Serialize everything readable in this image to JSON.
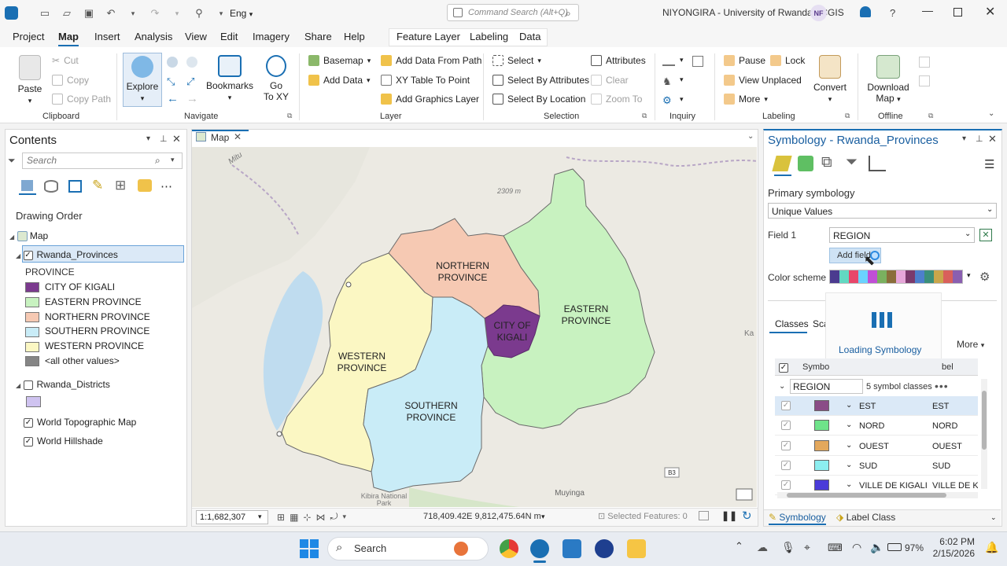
{
  "titlebar": {
    "language": "Eng",
    "command_search_placeholder": "Command Search (Alt+Q)",
    "user": "NIYONGIRA - University of Rwanda - CGIS",
    "avatar_initials": "NF",
    "help": "?"
  },
  "menu": {
    "tabs": [
      "Project",
      "Map",
      "Insert",
      "Analysis",
      "View",
      "Edit",
      "Imagery",
      "Share",
      "Help"
    ],
    "active": "Map",
    "contextual_tabs": [
      "Feature Layer",
      "Labeling",
      "Data"
    ]
  },
  "ribbon": {
    "clipboard": {
      "paste": "Paste",
      "cut": "Cut",
      "copy": "Copy",
      "copy_path": "Copy Path",
      "group": "Clipboard"
    },
    "navigate": {
      "explore": "Explore",
      "bookmarks": "Bookmarks",
      "go_to_xy": [
        "Go",
        "To XY"
      ],
      "group": "Navigate"
    },
    "layer": {
      "basemap": "Basemap",
      "add_data": "Add Data",
      "add_data_from_path": "Add Data From Path",
      "xy_table": "XY Table To Point",
      "add_graphics": "Add Graphics Layer",
      "group": "Layer"
    },
    "selection": {
      "select": "Select",
      "by_attributes": "Select By Attributes",
      "by_location": "Select By Location",
      "attributes": "Attributes",
      "clear": "Clear",
      "zoom_to": "Zoom To",
      "group": "Selection"
    },
    "inquiry": {
      "group": "Inquiry"
    },
    "labeling": {
      "pause": "Pause",
      "lock": "Lock",
      "view_unplaced": "View Unplaced",
      "more": "More",
      "convert": "Convert",
      "group": "Labeling"
    },
    "offline": {
      "download": [
        "Download",
        "Map"
      ],
      "group": "Offline"
    }
  },
  "contents": {
    "title": "Contents",
    "search_placeholder": "Search",
    "drawing_order": "Drawing Order",
    "map_label": "Map",
    "layer_provinces": "Rwanda_Provinces",
    "field_heading": "PROVINCE",
    "legend": [
      {
        "label": "CITY OF KIGALI",
        "color": "#7b3a8e"
      },
      {
        "label": "EASTERN PROVINCE",
        "color": "#c8f2c0"
      },
      {
        "label": "NORTHERN PROVINCE",
        "color": "#f6c9b3"
      },
      {
        "label": "SOUTHERN PROVINCE",
        "color": "#c9ecf7"
      },
      {
        "label": "WESTERN PROVINCE",
        "color": "#fbf7c3"
      },
      {
        "label": "<all other values>",
        "color": "#858585"
      }
    ],
    "layer_districts": "Rwanda_Districts",
    "districts_color": "#cfc3f0",
    "basemaps": [
      "World Topographic Map",
      "World Hillshade"
    ]
  },
  "map": {
    "tab": "Map",
    "labels": {
      "northern": [
        "NORTHERN",
        "PROVINCE"
      ],
      "eastern": [
        "EASTERN",
        "PROVINCE"
      ],
      "kigali": [
        "CITY OF",
        "KIGALI"
      ],
      "western": [
        "WESTERN",
        "PROVINCE"
      ],
      "southern": [
        "SOUTHERN",
        "PROVINCE"
      ]
    },
    "base_labels": {
      "elev": "2309 m",
      "mitu": "Mitu",
      "ka": "Ka",
      "kibira": [
        "Kibira National",
        "Park"
      ],
      "muyinga": "Muyinga",
      "b3": "B3"
    },
    "scale": "1:1,682,307",
    "coords": "718,409.42E 9,812,475.64N m",
    "selected_features": "Selected Features: 0"
  },
  "symbology": {
    "title": "Symbology - Rwanda_Provinces",
    "primary": "Primary symbology",
    "method": "Unique Values",
    "field_label": "Field 1",
    "field_value": "REGION",
    "add_field": "Add field",
    "color_scheme_label": "Color scheme",
    "scheme_colors": [
      "#4b3b8f",
      "#62d9c2",
      "#e8466a",
      "#6ad3ff",
      "#c04fd6",
      "#7ab05f",
      "#8a6d3b",
      "#e6a6d9",
      "#7b3a6c",
      "#4d7fcc",
      "#3b8f7a",
      "#c9a64b",
      "#d9605b",
      "#8a5fb0"
    ],
    "tabs": [
      "Classes",
      "Sca"
    ],
    "loading": "Loading Symbology",
    "more": "More",
    "col_symbol": "Symbo",
    "col_label": "bel",
    "group_field": "REGION",
    "group_count": "5 symbol classes",
    "rows": [
      {
        "value": "EST",
        "label": "EST",
        "color": "#8a4c87"
      },
      {
        "value": "NORD",
        "label": "NORD",
        "color": "#6fe38a"
      },
      {
        "value": "OUEST",
        "label": "OUEST",
        "color": "#e3a85d"
      },
      {
        "value": "SUD",
        "label": "SUD",
        "color": "#8ceef0"
      },
      {
        "value": "VILLE DE KIGALI",
        "label": "VILLE DE KIG",
        "color": "#4a3bd9"
      }
    ],
    "bottom_tabs": [
      "Symbology",
      "Label Class"
    ]
  },
  "taskbar": {
    "search": "Search",
    "battery": "97%",
    "time": "6:02 PM",
    "date": "2/15/2026"
  }
}
